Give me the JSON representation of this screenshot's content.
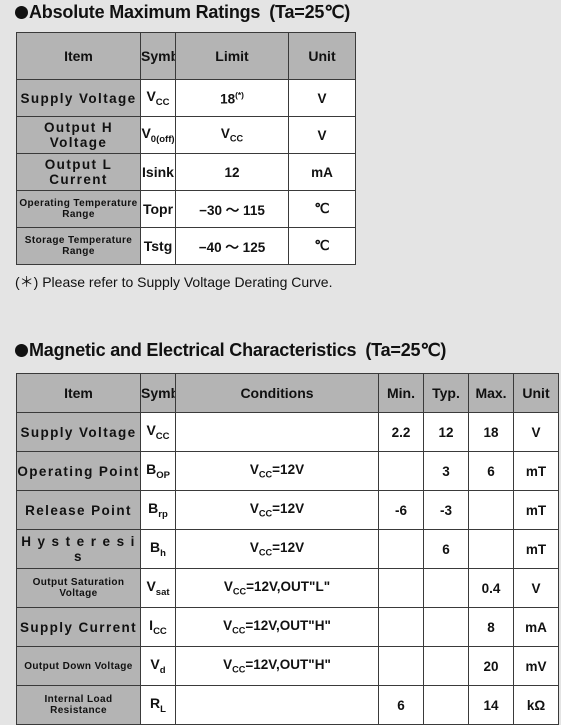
{
  "sections": {
    "absolute": {
      "bullet": "filled-circle-bullet",
      "title": "Absolute Maximum Ratings",
      "condition": "(Ta=25℃)",
      "columns": [
        "Item",
        "Symbol",
        "Limit",
        "Unit"
      ],
      "rows": [
        {
          "item": "Supply  Voltage",
          "item_small": false,
          "symbol_base": "V",
          "symbol_sub": "CC",
          "limit": "18",
          "limit_sup": "(*)",
          "unit": "V"
        },
        {
          "item": "Output H Voltage",
          "item_small": false,
          "symbol_base": "V",
          "symbol_sub": "0(off)",
          "limit_base": "V",
          "limit_sub": "CC",
          "unit": "V"
        },
        {
          "item": "Output L Current",
          "item_small": false,
          "symbol_base": "Isink",
          "symbol_sub": "",
          "limit": "12",
          "unit": "mA"
        },
        {
          "item": "Operating  Temperature  Range",
          "item_small": true,
          "symbol_base": "Topr",
          "symbol_sub": "",
          "limit": "−30 ～ 115",
          "unit": "℃"
        },
        {
          "item": "Storage Temperature Range",
          "item_small": true,
          "symbol_base": "Tstg",
          "symbol_sub": "",
          "limit": "−40 ～ 125",
          "unit": "℃"
        }
      ],
      "footnote": "(＊) Please refer to Supply Voltage Derating Curve."
    },
    "magnetic": {
      "bullet": "filled-circle-bullet",
      "title": "Magnetic and Electrical Characteristics",
      "condition": "(Ta=25℃)",
      "columns": [
        "Item",
        "Symbol",
        "Conditions",
        "Min.",
        "Typ.",
        "Max.",
        "Unit"
      ],
      "rows": [
        {
          "item": "Supply  Voltage",
          "item_small": false,
          "symbol_base": "V",
          "symbol_sub": "CC",
          "cond_base": "",
          "cond_sub": "",
          "cond_tail": "",
          "min": "2.2",
          "typ": "12",
          "max": "18",
          "unit": "V"
        },
        {
          "item": "Operating Point",
          "item_small": false,
          "symbol_base": "B",
          "symbol_sub": "OP",
          "cond_base": "V",
          "cond_sub": "CC",
          "cond_tail": "=12V",
          "min": "",
          "typ": "3",
          "max": "6",
          "unit": "mT"
        },
        {
          "item": "Release  Point",
          "item_small": false,
          "symbol_base": "B",
          "symbol_sub": "rp",
          "cond_base": "V",
          "cond_sub": "CC",
          "cond_tail": "=12V",
          "min": "-6",
          "typ": "-3",
          "max": "",
          "unit": "mT"
        },
        {
          "item": "H y s t e r e s i s",
          "item_small": false,
          "symbol_base": "B",
          "symbol_sub": "h",
          "cond_base": "V",
          "cond_sub": "CC",
          "cond_tail": "=12V",
          "min": "",
          "typ": "6",
          "max": "",
          "unit": "mT"
        },
        {
          "item": "Output Saturation Voltage",
          "item_small": true,
          "symbol_base": "V",
          "symbol_sub": "sat",
          "cond_base": "V",
          "cond_sub": "CC",
          "cond_tail": "=12V,OUT\"L\"",
          "min": "",
          "typ": "",
          "max": "0.4",
          "unit": "V"
        },
        {
          "item": "Supply  Current",
          "item_small": false,
          "symbol_base": "I",
          "symbol_sub": "CC",
          "cond_base": "V",
          "cond_sub": "CC",
          "cond_tail": "=12V,OUT\"H\"",
          "min": "",
          "typ": "",
          "max": "8",
          "unit": "mA"
        },
        {
          "item": "Output  Down  Voltage",
          "item_small": true,
          "symbol_base": "V",
          "symbol_sub": "d",
          "cond_base": "V",
          "cond_sub": "CC",
          "cond_tail": "=12V,OUT\"H\"",
          "min": "",
          "typ": "",
          "max": "20",
          "unit": "mV"
        },
        {
          "item": "Internal  Load  Resistance",
          "item_small": true,
          "symbol_base": "R",
          "symbol_sub": "L",
          "cond_base": "",
          "cond_sub": "",
          "cond_tail": "",
          "min": "6",
          "typ": "",
          "max": "14",
          "unit": "kΩ"
        }
      ]
    }
  },
  "colors": {
    "page_background": "#e4e4e4",
    "header_fill": "#b4b4b4",
    "cell_fill": "#ffffff",
    "border": "#3a3a3a",
    "text": "#111111"
  }
}
